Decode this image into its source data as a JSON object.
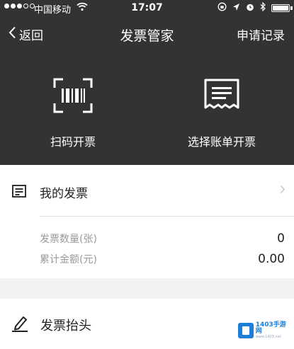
{
  "status_bar": {
    "carrier": "中国移动",
    "time": "17:07",
    "battery_level": 1.0
  },
  "nav": {
    "back_label": "返回",
    "title": "发票管家",
    "right_label": "申请记录"
  },
  "actions": [
    {
      "label": "扫码开票",
      "icon": "barcode-scan-icon"
    },
    {
      "label": "选择账单开票",
      "icon": "receipt-icon"
    }
  ],
  "my_invoices": {
    "label": "我的发票",
    "icon": "invoice-list-icon",
    "stats": [
      {
        "label": "发票数量(张)",
        "value": "0"
      },
      {
        "label": "累计金额(元)",
        "value": "0.00"
      }
    ]
  },
  "invoice_header": {
    "label": "发票抬头",
    "icon": "pen-icon"
  },
  "watermark": {
    "text": "1403手游网",
    "sub": "www.1403.net"
  },
  "colors": {
    "header_bg": "#333333",
    "page_bg": "#f2f2f2",
    "card_bg": "#ffffff",
    "muted_text": "#999999"
  }
}
